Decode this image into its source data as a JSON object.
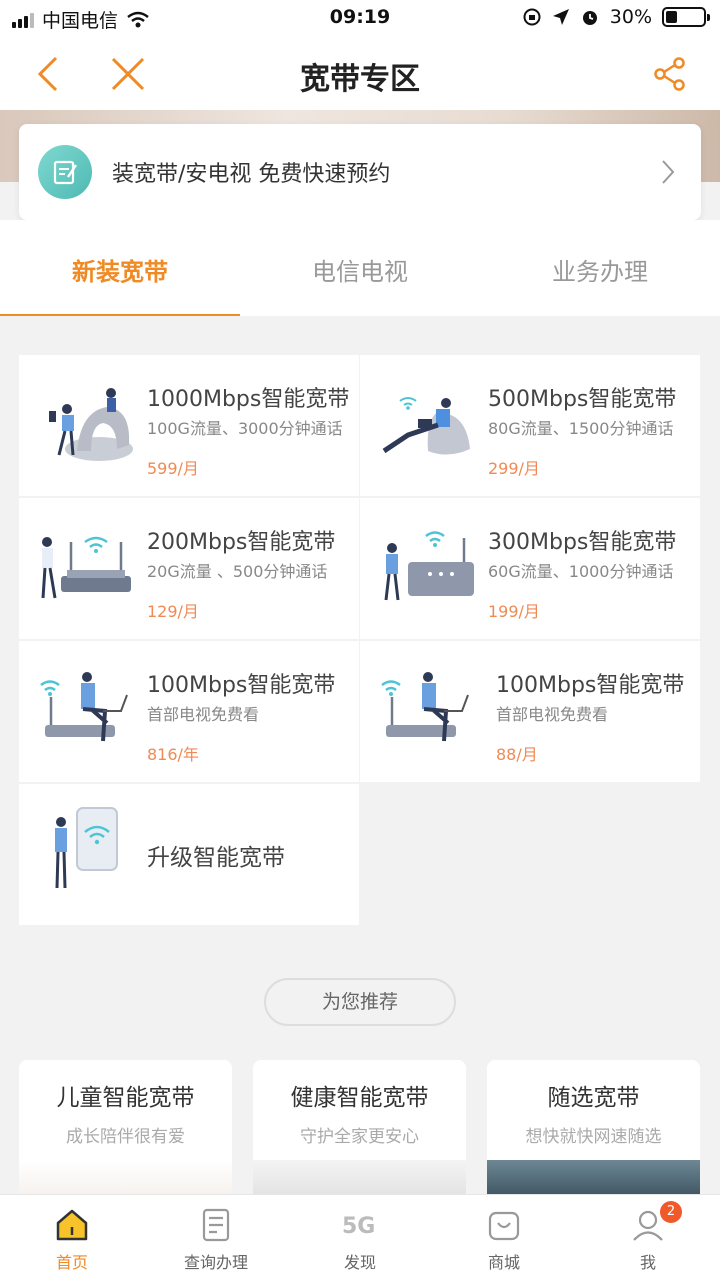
{
  "status_bar": {
    "carrier": "中国电信",
    "time": "09:19",
    "battery": "30%"
  },
  "header": {
    "title": "宽带专区",
    "back_icon": "chevron-left-icon",
    "close_icon": "close-icon",
    "share_icon": "share-icon",
    "accent": "#f08a24"
  },
  "appointment": {
    "label": "装宽带/安电视 免费快速预约"
  },
  "tabs": [
    {
      "label": "新装宽带",
      "active": true
    },
    {
      "label": "电信电视",
      "active": false
    },
    {
      "label": "业务办理",
      "active": false
    }
  ],
  "products": [
    {
      "name": "1000Mbps智能宽带",
      "desc": "100G流量、3000分钟通话",
      "price": "599/月"
    },
    {
      "name": "500Mbps智能宽带",
      "desc": "80G流量、1500分钟通话",
      "price": "299/月"
    },
    {
      "name": "200Mbps智能宽带",
      "desc": "20G流量 、500分钟通话",
      "price": "129/月"
    },
    {
      "name": "300Mbps智能宽带",
      "desc": "60G流量、1000分钟通话",
      "price": "199/月"
    },
    {
      "name": "100Mbps智能宽带",
      "desc": "首部电视免费看",
      "price": "816/年"
    },
    {
      "name": "100Mbps智能宽带",
      "desc": "首部电视免费看",
      "price": "88/月"
    }
  ],
  "upgrade": {
    "label": "升级智能宽带"
  },
  "recommend": {
    "pill": "为您推荐",
    "cards": [
      {
        "title": "儿童智能宽带",
        "subtitle": "成长陪伴很有爱"
      },
      {
        "title": "健康智能宽带",
        "subtitle": "守护全家更安心"
      },
      {
        "title": "随选宽带",
        "subtitle": "想快就快网速随选"
      }
    ]
  },
  "tabbar": {
    "items": [
      {
        "label": "首页",
        "icon": "home-icon",
        "active": true
      },
      {
        "label": "查询办理",
        "icon": "document-icon",
        "active": false
      },
      {
        "label": "发现",
        "icon": "5g-icon",
        "active": false
      },
      {
        "label": "商城",
        "icon": "shopping-bag-icon",
        "active": false
      },
      {
        "label": "我",
        "icon": "user-icon",
        "active": false
      }
    ],
    "badge": "2"
  }
}
